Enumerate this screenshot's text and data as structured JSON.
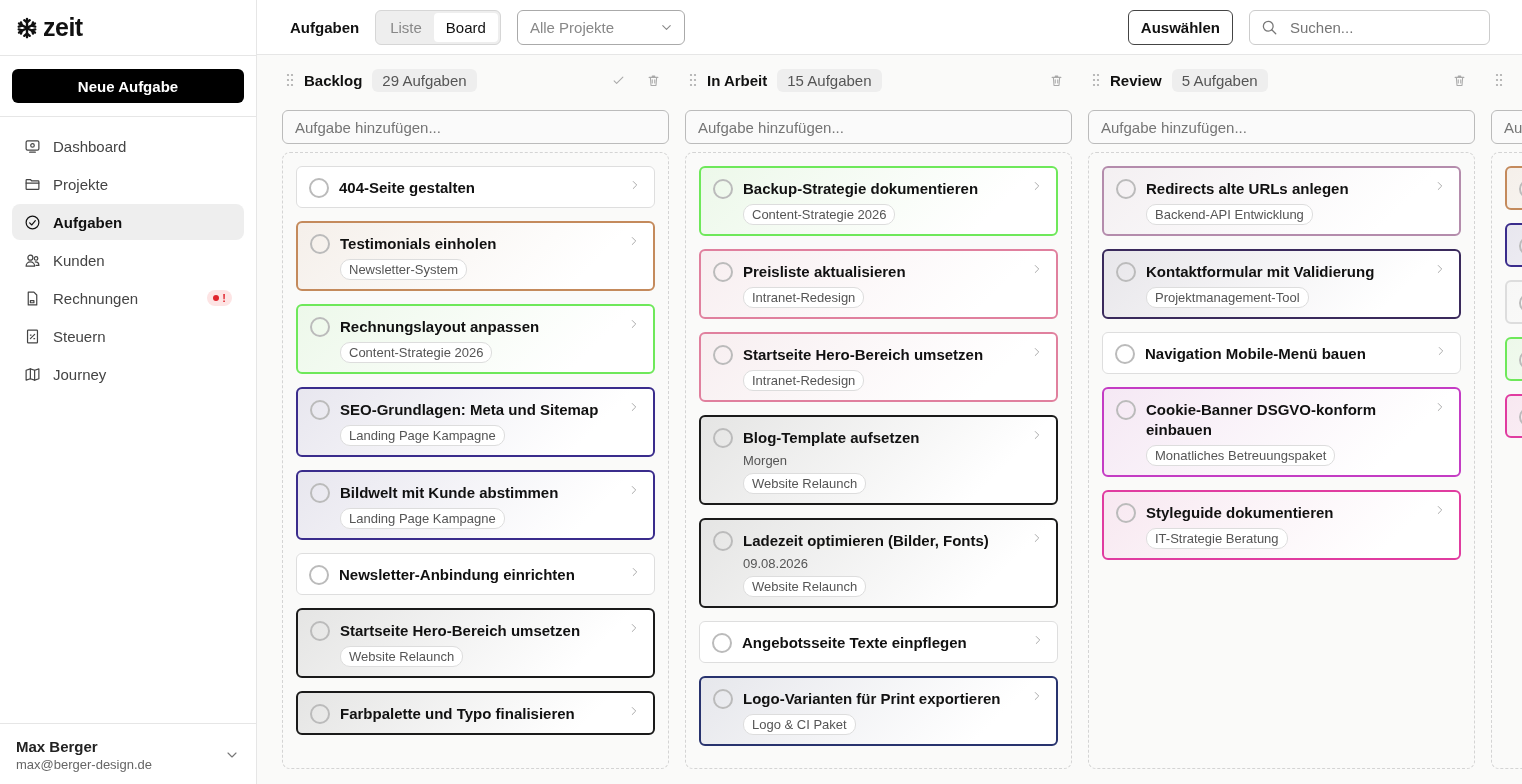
{
  "app": {
    "logo_text": "zeit"
  },
  "sidebar": {
    "new_button": "Neue Aufgabe",
    "items": [
      {
        "label": "Dashboard",
        "selected": false
      },
      {
        "label": "Projekte",
        "selected": false
      },
      {
        "label": "Aufgaben",
        "selected": true
      },
      {
        "label": "Kunden",
        "selected": false
      },
      {
        "label": "Rechnungen",
        "selected": false,
        "badge": "!"
      },
      {
        "label": "Steuern",
        "selected": false
      },
      {
        "label": "Journey",
        "selected": false
      }
    ],
    "user": {
      "name": "Max Berger",
      "email": "max@berger-design.de"
    }
  },
  "toolbar": {
    "title": "Aufgaben",
    "views": [
      {
        "label": "Liste",
        "selected": false
      },
      {
        "label": "Board",
        "selected": true
      }
    ],
    "project_filter": "Alle Projekte",
    "select_button": "Auswählen",
    "search": {
      "placeholder": "Suchen..."
    }
  },
  "columns": [
    {
      "title": "Backlog",
      "count": "29 Aufgaben",
      "done_action": true,
      "add_placeholder": "Aufgabe hinzufügen...",
      "cards": [
        {
          "title": "404-Seite gestalten"
        },
        {
          "title": "Testimonials einholen",
          "tag": "Newsletter-System",
          "color": "#c48a5c"
        },
        {
          "title": "Rechnungslayout anpassen",
          "tag": "Content-Strategie 2026",
          "color": "#6ee85a"
        },
        {
          "title": "SEO-Grundlagen: Meta und Sitemap",
          "tag": "Landing Page Kampagne",
          "color": "#3a2c8c"
        },
        {
          "title": "Bildwelt mit Kunde abstimmen",
          "tag": "Landing Page Kampagne",
          "color": "#3a2c8c"
        },
        {
          "title": "Newsletter-Anbindung einrichten"
        },
        {
          "title": "Startseite Hero-Bereich umsetzen",
          "tag": "Website Relaunch",
          "color": "#1a1a1a"
        },
        {
          "title": "Farbpalette und Typo finalisieren",
          "color": "#1a1a1a"
        }
      ]
    },
    {
      "title": "In Arbeit",
      "count": "15 Aufgaben",
      "done_action": false,
      "add_placeholder": "Aufgabe hinzufügen...",
      "cards": [
        {
          "title": "Backup-Strategie dokumentieren",
          "tag": "Content-Strategie 2026",
          "color": "#6ee85a"
        },
        {
          "title": "Preisliste aktualisieren",
          "tag": "Intranet-Redesign",
          "color": "#e0809e"
        },
        {
          "title": "Startseite Hero-Bereich umsetzen",
          "tag": "Intranet-Redesign",
          "color": "#e0809e"
        },
        {
          "title": "Blog-Template aufsetzen",
          "date": "Morgen",
          "tag": "Website Relaunch",
          "color": "#1a1a1a"
        },
        {
          "title": "Ladezeit optimieren (Bilder, Fonts)",
          "date": "09.08.2026",
          "tag": "Website Relaunch",
          "color": "#1a1a1a"
        },
        {
          "title": "Angebotsseite Texte einpflegen"
        },
        {
          "title": "Logo-Varianten für Print exportieren",
          "tag": "Logo & CI Paket",
          "color": "#28336e"
        }
      ]
    },
    {
      "title": "Review",
      "count": "5 Aufgaben",
      "done_action": false,
      "add_placeholder": "Aufgabe hinzufügen...",
      "cards": [
        {
          "title": "Redirects alte URLs anlegen",
          "tag": "Backend-API Entwicklung",
          "color": "#b48cac"
        },
        {
          "title": "Kontaktformular mit Validierung",
          "tag": "Projektmanagement-Tool",
          "color": "#3a2a5c"
        },
        {
          "title": "Navigation Mobile-Menü bauen"
        },
        {
          "title": "Cookie-Banner DSGVO-konform einbauen",
          "tag": "Monatliches Betreuungspaket",
          "color": "#c43cc4"
        },
        {
          "title": "Styleguide dokumentieren",
          "tag": "IT-Strategie Beratung",
          "color": "#e03ca0"
        }
      ]
    },
    {
      "add_placeholder": "Au",
      "cards": [
        {
          "color": "#c48a5c"
        },
        {
          "color": "#3a2c8c"
        },
        {
          "color": "#dddddd"
        },
        {
          "color": "#6ee85a"
        },
        {
          "color": "#e03ca0"
        }
      ]
    }
  ]
}
